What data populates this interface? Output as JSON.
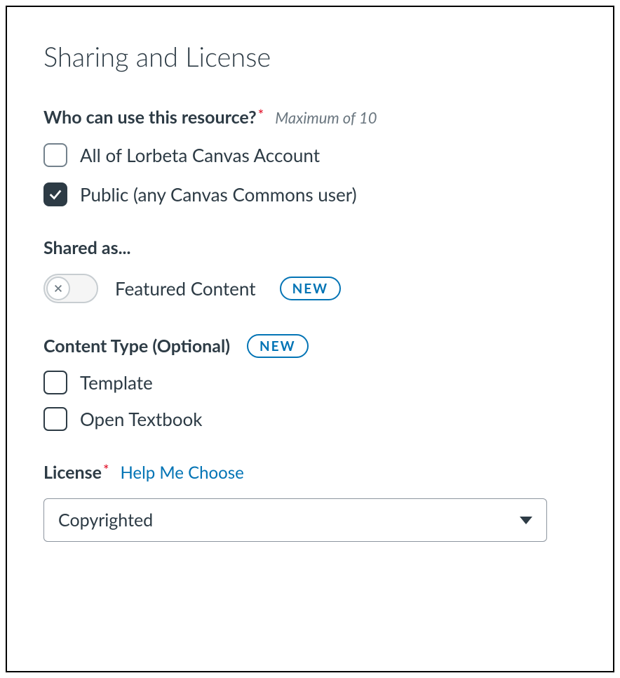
{
  "title": "Sharing and License",
  "whoCanUse": {
    "label": "Who can use this resource?",
    "hint": "Maximum of 10",
    "options": [
      {
        "label": "All of Lorbeta Canvas Account",
        "checked": false
      },
      {
        "label": "Public (any Canvas Commons user)",
        "checked": true
      }
    ]
  },
  "sharedAs": {
    "label": "Shared as...",
    "toggleLabel": "Featured Content",
    "badge": "NEW",
    "toggleOn": false
  },
  "contentType": {
    "label": "Content Type (Optional)",
    "badge": "NEW",
    "options": [
      {
        "label": "Template",
        "checked": false
      },
      {
        "label": "Open Textbook",
        "checked": false
      }
    ]
  },
  "license": {
    "label": "License",
    "helpLink": "Help Me Choose",
    "selected": "Copyrighted"
  }
}
